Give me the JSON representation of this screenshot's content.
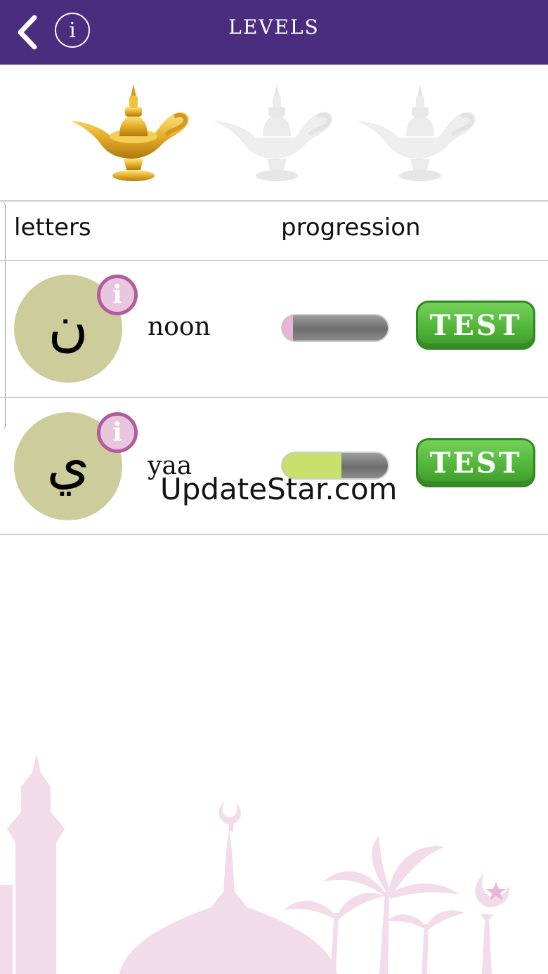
{
  "header": {
    "title": "LEVELS",
    "back_icon": "chevron-left-icon",
    "info_icon_text": "i"
  },
  "lamps": [
    {
      "name": "lamp-1",
      "state": "earned",
      "color": "#f0c23a"
    },
    {
      "name": "lamp-2",
      "state": "locked",
      "color": "#eeeeee"
    },
    {
      "name": "lamp-3",
      "state": "locked",
      "color": "#eeeeee"
    }
  ],
  "table": {
    "col_letters": "letters",
    "col_progression": "progression",
    "rows": [
      {
        "glyph": "ن",
        "name": "noon",
        "info": "i",
        "progress": 0.1,
        "progress_color": "#e8b4d7",
        "test_label": "TEST"
      },
      {
        "glyph": "ي",
        "name": "yaa",
        "info": "i",
        "progress": 0.56,
        "progress_color": "#c9e06c",
        "test_label": "TEST"
      }
    ]
  },
  "watermark": "UpdateStar.com",
  "colors": {
    "header": "#4a2d7e",
    "circle": "#cdcd9b",
    "badge_border": "#b15c9d",
    "test_green": "#4fb338",
    "skyline": "#f2dcea"
  }
}
